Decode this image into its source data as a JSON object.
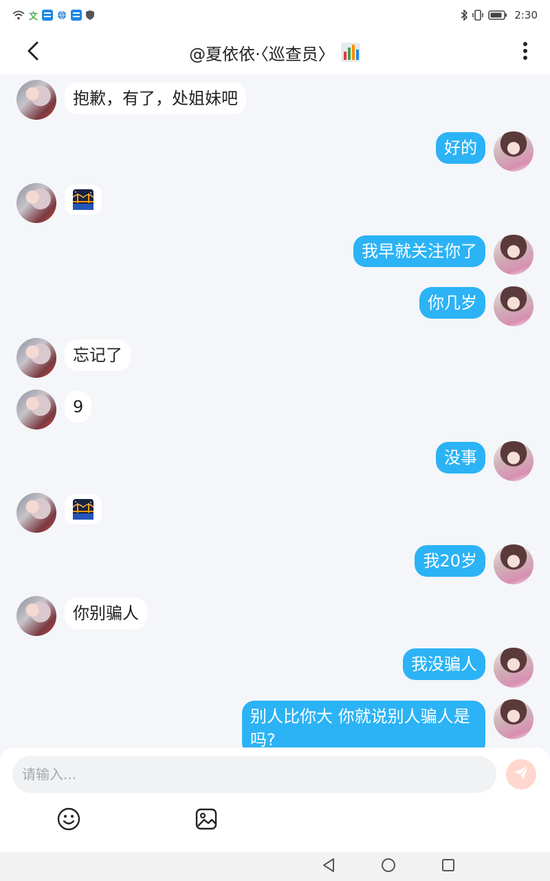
{
  "status_bar": {
    "wen_label": "文",
    "time": "2:30",
    "icons": [
      "wifi-icon",
      "app-icon",
      "app-icon",
      "globe-icon",
      "shield-icon",
      "bluetooth-icon",
      "vibrate-icon",
      "battery-icon"
    ]
  },
  "header": {
    "title": "@夏依依·〈巡查员〉",
    "back_icon": "chevron-left-icon",
    "more_icon": "more-vertical-icon",
    "title_emoji": "bar-chart-emoji"
  },
  "messages": [
    {
      "side": "left",
      "type": "text",
      "text": "抱歉，有了，处姐妹吧"
    },
    {
      "side": "right",
      "type": "text",
      "text": "好的"
    },
    {
      "side": "left",
      "type": "sticker",
      "sticker": "bridge-at-night-emoji"
    },
    {
      "side": "right",
      "type": "text",
      "text": "我早就关注你了"
    },
    {
      "side": "right",
      "type": "text",
      "text": "你几岁"
    },
    {
      "side": "left",
      "type": "text",
      "text": "忘记了"
    },
    {
      "side": "left",
      "type": "text",
      "text": "9"
    },
    {
      "side": "right",
      "type": "text",
      "text": "没事"
    },
    {
      "side": "left",
      "type": "sticker",
      "sticker": "bridge-at-night-emoji"
    },
    {
      "side": "right",
      "type": "text",
      "text": "我20岁"
    },
    {
      "side": "left",
      "type": "text",
      "text": "你别骗人"
    },
    {
      "side": "right",
      "type": "text",
      "text": "我没骗人"
    },
    {
      "side": "right",
      "type": "text",
      "text": "别人比你大 你就说别人骗人是吗?"
    }
  ],
  "input": {
    "placeholder": "请输入...",
    "value": "",
    "send_icon": "send-icon",
    "emoji_icon": "smiley-icon",
    "image_icon": "image-icon"
  },
  "nav_bar": {
    "icons": [
      "back-triangle-icon",
      "home-circle-icon",
      "recents-square-icon"
    ]
  },
  "colors": {
    "accent": "#2cb3f5",
    "background": "#f4f6f9",
    "send_button": "#ffd7cf"
  }
}
